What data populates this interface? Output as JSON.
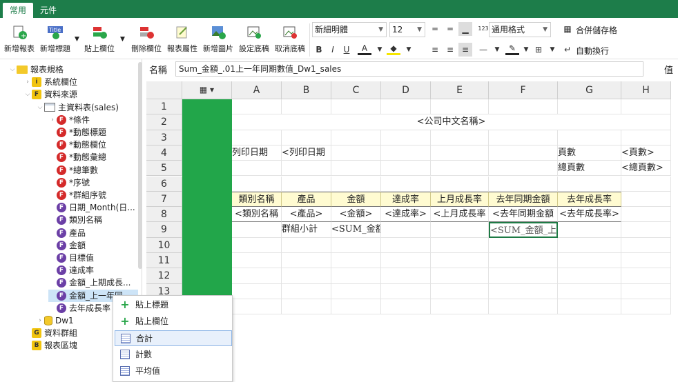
{
  "tabs": [
    "常用",
    "元件"
  ],
  "ribbon": {
    "buttons": [
      "新增報表",
      "新增標題",
      "貼上欄位",
      "刪除欄位",
      "報表屬性",
      "新增圖片",
      "設定底稿",
      "取消底稿"
    ],
    "font_name": "新細明體",
    "font_size": "12",
    "number_format": "通用格式",
    "merge_label": "合併儲存格",
    "wrap_label": "自動換行",
    "bold": "B",
    "italic": "I",
    "underline": "U",
    "font_color_letter": "A"
  },
  "tree": {
    "items": [
      {
        "label": "報表規格",
        "icon": "folder"
      },
      {
        "label": "系統欄位",
        "icon": "i"
      },
      {
        "label": "資料來源",
        "icon": "F"
      },
      {
        "label": "主資料表(sales)",
        "icon": "table"
      },
      {
        "label": "*條件",
        "icon": "F-red"
      },
      {
        "label": "*動態標題",
        "icon": "F-red"
      },
      {
        "label": "*動態欄位",
        "icon": "F-red"
      },
      {
        "label": "*動態彙總",
        "icon": "F-red"
      },
      {
        "label": "*總筆數",
        "icon": "F-red"
      },
      {
        "label": "*序號",
        "icon": "F-red"
      },
      {
        "label": "*群組序號",
        "icon": "F-red"
      },
      {
        "label": "日期_Month(日...",
        "icon": "F-purple"
      },
      {
        "label": "類別名稱",
        "icon": "F-purple"
      },
      {
        "label": "產品",
        "icon": "F-purple"
      },
      {
        "label": "金額",
        "icon": "F-purple"
      },
      {
        "label": "目標值",
        "icon": "F-purple"
      },
      {
        "label": "達成率",
        "icon": "F-purple"
      },
      {
        "label": "金額_上期成長...",
        "icon": "F-purple"
      },
      {
        "label": "金額_上一年同",
        "icon": "F-purple"
      },
      {
        "label": "去年成長率",
        "icon": "F-purple"
      },
      {
        "label": "Dw1",
        "icon": "db"
      },
      {
        "label": "資料群組",
        "icon": "G"
      },
      {
        "label": "報表區塊",
        "icon": "B"
      }
    ]
  },
  "namebar": {
    "label": "名稱",
    "value": "Sum_金額_.01上一年同期數值_Dw1_sales",
    "value_label": "值"
  },
  "grid": {
    "columns": [
      "A",
      "B",
      "C",
      "D",
      "E",
      "F",
      "G",
      "H"
    ],
    "rows": [
      "1",
      "2",
      "3",
      "4",
      "5",
      "6",
      "7",
      "8",
      "9",
      "10",
      "11",
      "12",
      "13"
    ],
    "cells": {
      "company": "<公司中文名稱>",
      "print_date_label": "列印日期",
      "print_date_value": "<列印日期",
      "page_label": "頁數",
      "page_value": "<頁數>",
      "total_pages_label": "總頁數",
      "total_pages_value": "<總頁數>",
      "headers": [
        "類別名稱",
        "產品",
        "金額",
        "達成率",
        "上月成長率",
        "去年同期金額",
        "去年成長率"
      ],
      "data": [
        "<類別名稱",
        "<產品>",
        "<金額>",
        "<達成率>",
        "<上月成長率",
        "<去年同期金額",
        "<去年成長率>"
      ],
      "group_subtotal": "群組小計",
      "sum_amount": "<SUM_金額",
      "sum_selected": "<SUM_金額_上"
    }
  },
  "context_menu": {
    "items": [
      "貼上標題",
      "貼上欄位",
      "合計",
      "計數",
      "平均值"
    ]
  },
  "colors": {
    "accent": "#1d7d4a",
    "green_column": "#22a64a",
    "header_fill": "#fffbd1",
    "selection": "#cde4f7"
  }
}
